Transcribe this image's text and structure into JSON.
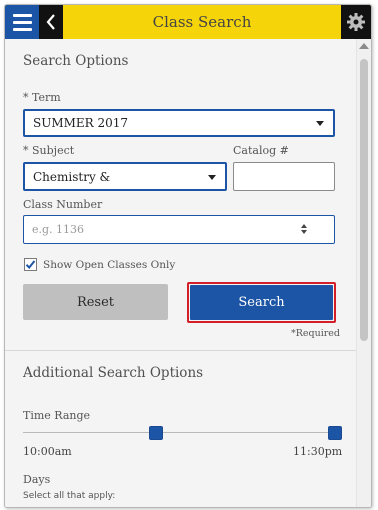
{
  "header": {
    "title": "Class Search",
    "menu_icon": "hamburger-icon",
    "back_icon": "chevron-left-icon",
    "settings_icon": "gear-icon",
    "colors": {
      "bar": "#f5d40a",
      "menu": "#1d55a6",
      "dark": "#111111"
    }
  },
  "search_options": {
    "title": "Search Options",
    "term": {
      "label": "* Term",
      "value": "SUMMER 2017"
    },
    "subject": {
      "label": "* Subject",
      "value": "Chemistry &"
    },
    "catalog": {
      "label": "Catalog #",
      "value": ""
    },
    "class_number": {
      "label": "Class Number",
      "placeholder": "e.g. 1136"
    },
    "open_only": {
      "label": "Show Open Classes Only",
      "checked": true
    },
    "reset_label": "Reset",
    "search_label": "Search",
    "required_note": "*Required"
  },
  "additional": {
    "title": "Additional Search Options",
    "time_range": {
      "label": "Time Range",
      "start": "10:00am",
      "end": "11:30pm"
    },
    "days": {
      "label": "Days",
      "note": "Select all that apply:"
    }
  },
  "colors": {
    "accent": "#1d55a6",
    "highlight": "#d21f2a"
  }
}
